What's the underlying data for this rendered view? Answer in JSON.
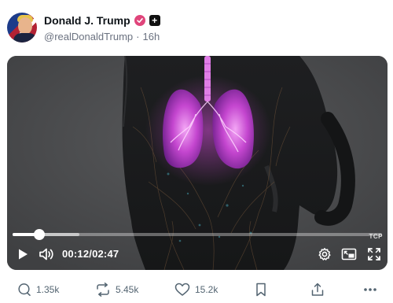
{
  "post": {
    "display_name": "Donald J. Trump",
    "handle": "@realDonaldTrump",
    "separator": "·",
    "time_ago": "16h"
  },
  "video": {
    "current_time": "00:12",
    "time_separator": "/",
    "duration": "02:47",
    "played_fraction": 0.072,
    "buffered_fraction": 0.18,
    "watermark": "TCP"
  },
  "actions": {
    "replies": "1.35k",
    "reposts": "5.45k",
    "likes": "15.2k"
  },
  "colors": {
    "verified_badge": "#e0457b",
    "lung_glow": "#d24bd6",
    "text_muted": "#536471"
  }
}
